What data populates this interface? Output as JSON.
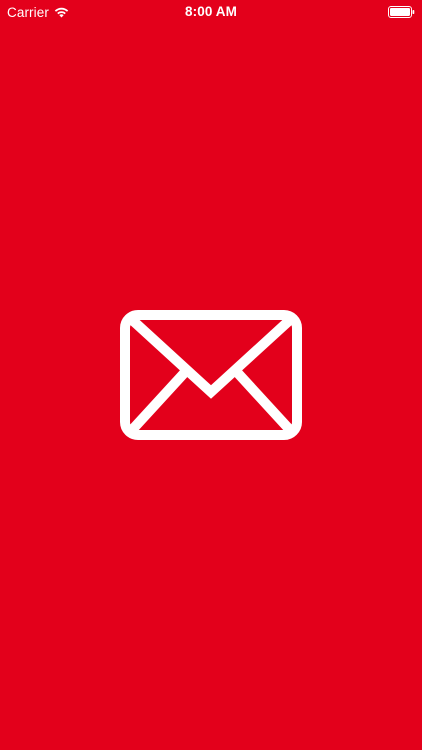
{
  "status_bar": {
    "carrier": "Carrier",
    "time": "8:00 AM",
    "wifi_icon": "wifi-icon",
    "battery_icon": "battery-full-icon",
    "battery_level": 1.0
  },
  "splash": {
    "icon": "envelope-icon",
    "background_color": "#E3001B",
    "icon_color": "#FFFFFF"
  }
}
